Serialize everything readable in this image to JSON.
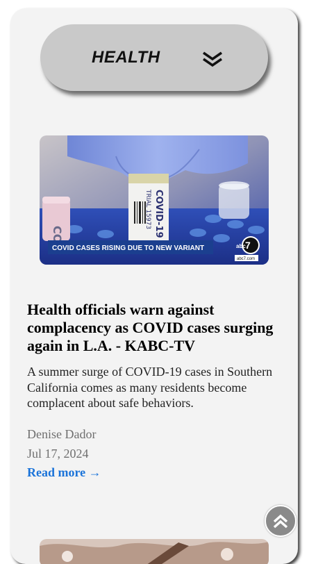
{
  "category": {
    "label": "HEALTH",
    "toggle_icon": "double-chevron-down-icon"
  },
  "article": {
    "image": {
      "banner_text": "COVID CASES RISING DUE TO NEW VARIANT",
      "tube_label": "COVID-19",
      "tube_sublabel": "TRIAL 15973",
      "tube_letters": "CO",
      "logo_text": "abc",
      "logo_number": "7",
      "logo_caption": "abc7.com"
    },
    "headline": "Health officials warn against complacency as COVID cases surging again in L.A. - KABC-TV",
    "summary": "A summer surge of COVID-19 cases in Southern California comes as many residents become complacent about safe behaviors.",
    "author": "Denise Dador",
    "date": "Jul 17, 2024",
    "read_more": "Read more →"
  },
  "scroll_top": {
    "icon": "double-chevron-up-icon"
  },
  "colors": {
    "card_bg": "#f3f3f3",
    "pill_bg": "#c9c9c9",
    "link": "#1a73d9",
    "meta_text": "#6f6f6f",
    "scroll_button": "#8a8a8a",
    "banner_bg": "#1b3f8f"
  }
}
